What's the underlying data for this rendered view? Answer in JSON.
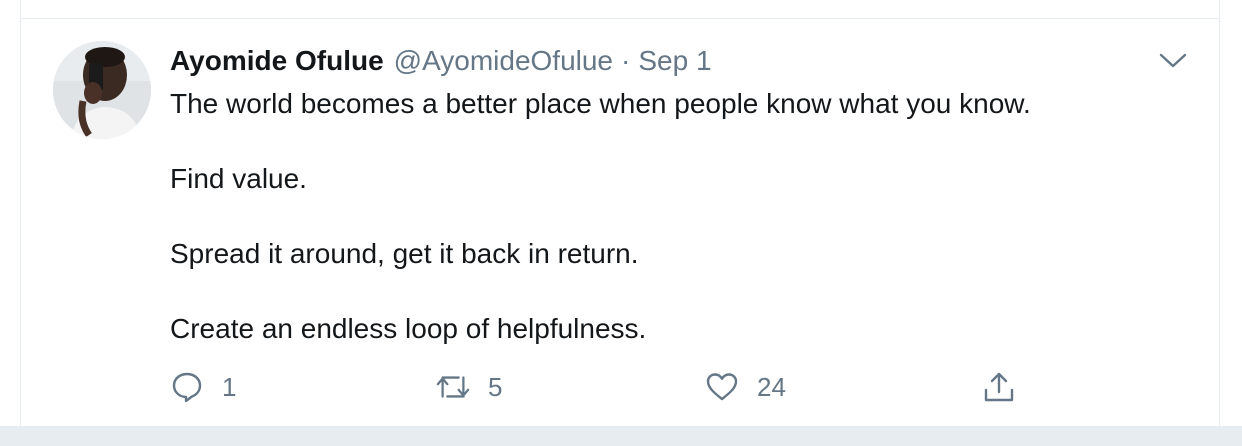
{
  "tweet": {
    "author": {
      "display_name": "Ayomide Ofulue",
      "handle": "@AyomideOfulue"
    },
    "separator": "·",
    "timestamp": "Sep 1",
    "paragraphs": [
      "The world becomes a better place when people know what you know.",
      "Find value.",
      "Spread it around, get it back in return.",
      "Create an endless loop of helpfulness."
    ],
    "actions": {
      "reply": {
        "icon": "reply-icon",
        "count": "1"
      },
      "retweet": {
        "icon": "retweet-icon",
        "count": "5"
      },
      "like": {
        "icon": "heart-icon",
        "count": "24"
      },
      "share": {
        "icon": "share-icon"
      }
    },
    "menu_icon": "chevron-down-icon"
  },
  "colors": {
    "text_primary": "#14171a",
    "text_secondary": "#657786",
    "border": "#e6ecf0",
    "background_band": "#e6ecf0"
  }
}
